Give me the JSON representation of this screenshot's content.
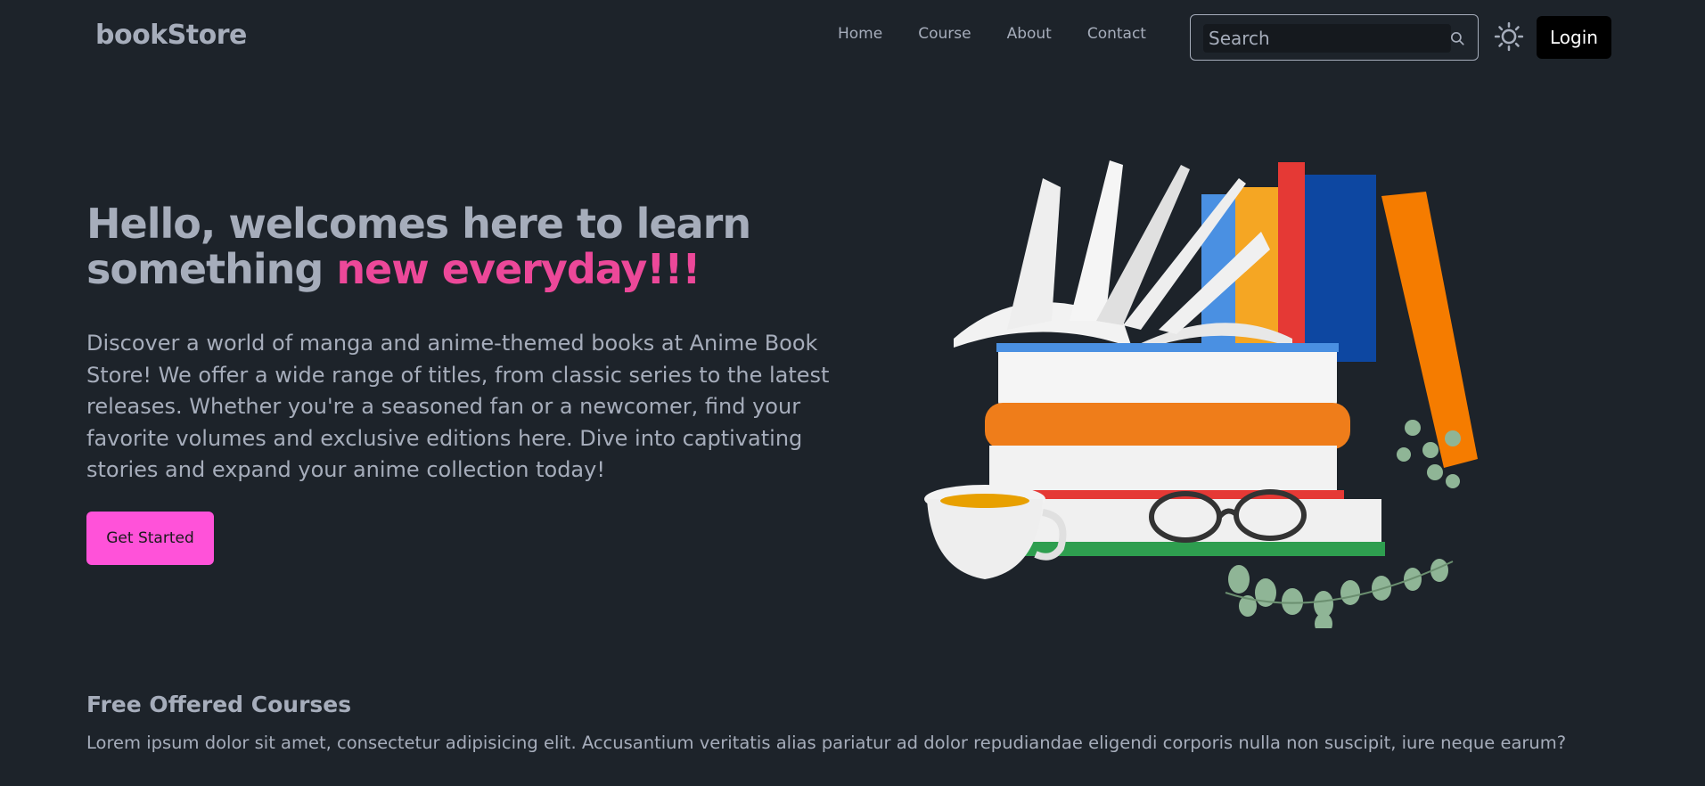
{
  "navbar": {
    "brand": "bookStore",
    "links": [
      "Home",
      "Course",
      "About",
      "Contact"
    ],
    "search_placeholder": "Search",
    "login_label": "Login"
  },
  "hero": {
    "title_part1": "Hello, welcomes here to learn something ",
    "title_accent": "new everyday!!!",
    "description": "Discover a world of manga and anime-themed books at Anime Book Store! We offer a wide range of titles, from classic series to the latest releases. Whether you're a seasoned fan or a newcomer, find your favorite volumes and exclusive editions here. Dive into captivating stories and expand your anime collection today!",
    "cta_label": "Get Started"
  },
  "courses": {
    "title": "Free Offered Courses",
    "description": "Lorem ipsum dolor sit amet, consectetur adipisicing elit. Accusantium veritatis alias pariatur ad dolor repudiandae eligendi corporis nulla non suscipit, iure neque earum?"
  },
  "colors": {
    "background": "#1d232a",
    "text": "#a6adbb",
    "accent": "#ec4899",
    "cta": "#ff52d9",
    "login": "#000000"
  },
  "icons": {
    "search": "search-icon",
    "theme": "sun-icon"
  }
}
